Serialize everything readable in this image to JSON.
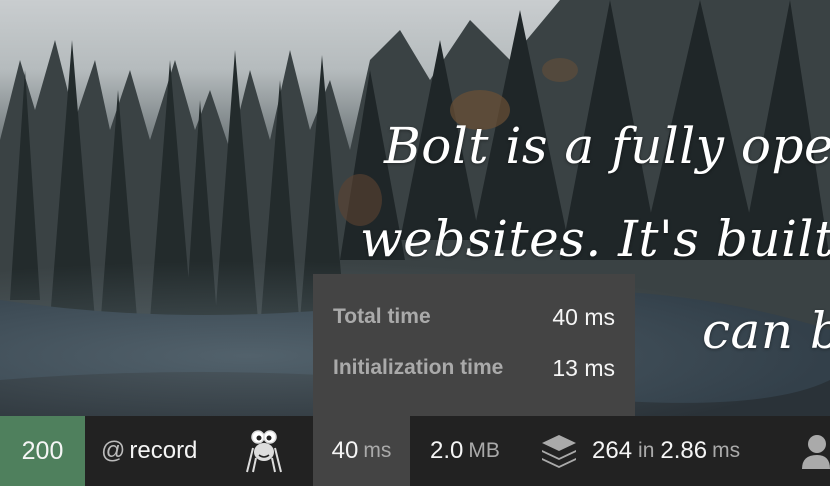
{
  "hero": {
    "line1": "Bolt is a fully ope",
    "line2": "websites. It's built",
    "line3": "can b"
  },
  "toolbar": {
    "status_code": "200",
    "route_prefix": "@",
    "route_name": "record",
    "time_value": "40",
    "time_unit": "ms",
    "memory_value": "2.0",
    "memory_unit": "MB",
    "db_queries": "264",
    "db_in": "in",
    "db_time": "2.86",
    "db_unit": "ms"
  },
  "time_panel": {
    "total_label": "Total time",
    "total_value": "40 ms",
    "init_label": "Initialization time",
    "init_value": "13 ms"
  },
  "colors": {
    "status_ok": "#4f805d",
    "toolbar_bg": "#222222",
    "panel_bg": "#444444"
  }
}
